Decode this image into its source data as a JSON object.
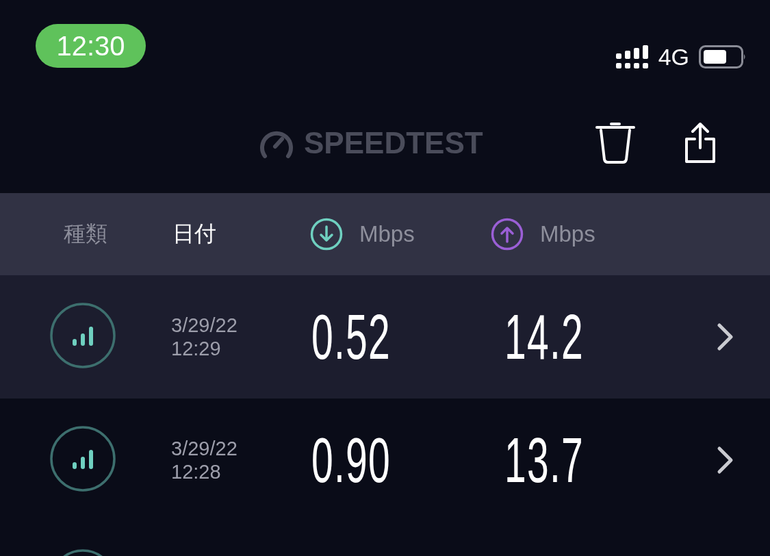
{
  "status_bar": {
    "time": "12:30",
    "network": "4G"
  },
  "header": {
    "logo": "SPEEDTEST"
  },
  "columns": [
    {
      "kind": "type",
      "label": "種類",
      "selected": false
    },
    {
      "kind": "date",
      "label": "日付",
      "selected": true
    },
    {
      "kind": "download",
      "label": "Mbps",
      "selected": false
    },
    {
      "kind": "upload",
      "label": "Mbps",
      "selected": false
    }
  ],
  "rows": [
    {
      "selected": true,
      "date": "3/29/22",
      "time": "12:29",
      "download": "0.52",
      "upload": "14.2"
    },
    {
      "selected": false,
      "date": "3/29/22",
      "time": "12:28",
      "download": "0.90",
      "upload": "13.7"
    },
    {
      "selected": false
    }
  ]
}
